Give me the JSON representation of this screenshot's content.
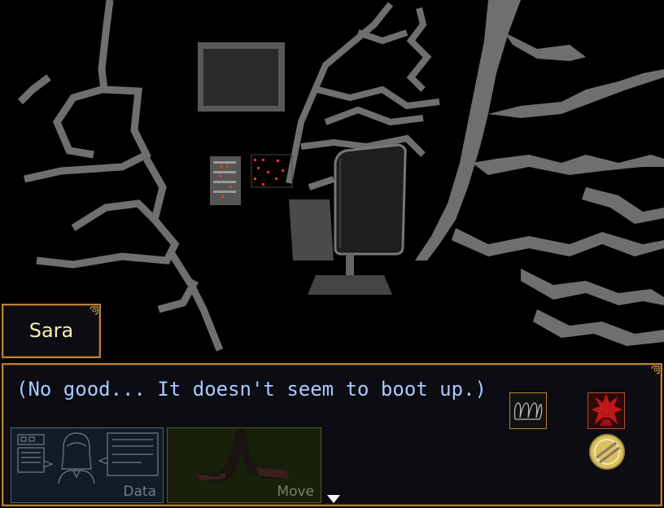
{
  "dialogue": {
    "speaker": "Sara",
    "text": "(No good... It doesn't seem to boot up.)"
  },
  "menu": {
    "data_label": "Data",
    "move_label": "Move"
  },
  "icons": {
    "inventory_item": "coiled-wire-icon",
    "portrait": "red-spiky-hair-portrait-icon",
    "token": "yellow-coin-icon",
    "advance": "triangle-down-icon"
  },
  "colors": {
    "frame": "#b9803a",
    "speaker_text": "#f3f0b0",
    "dialogue_text": "#a9c9ff",
    "crack": "#6f6f6f",
    "led": "#ff3030"
  }
}
